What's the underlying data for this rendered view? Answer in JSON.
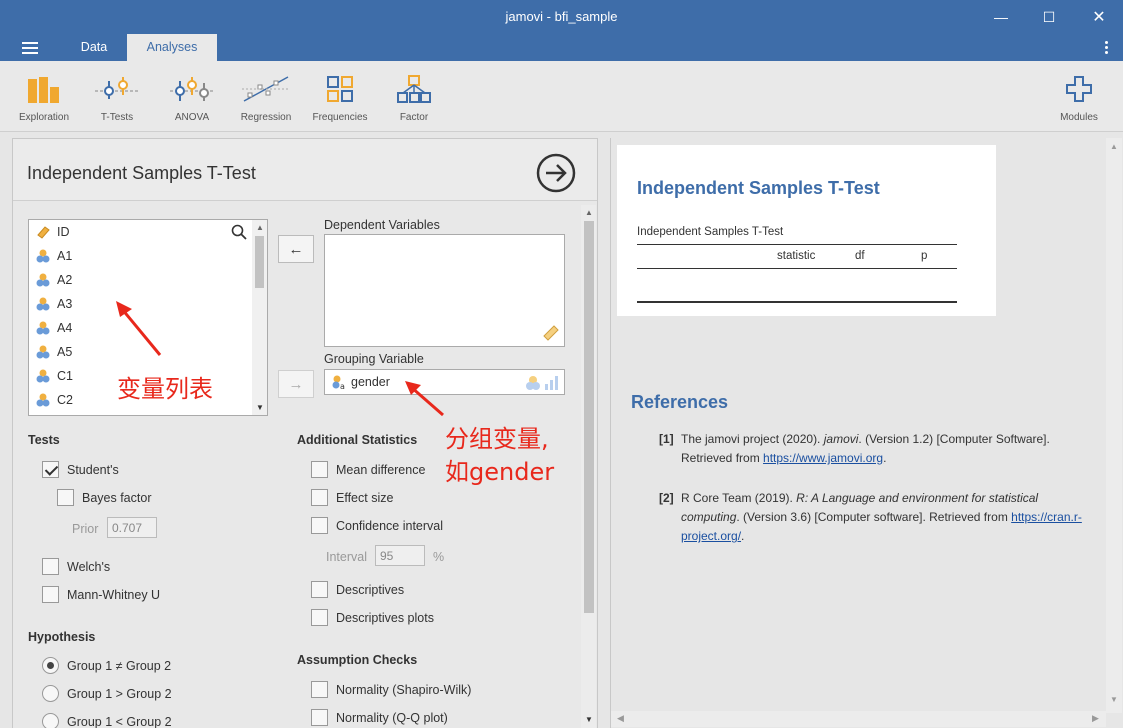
{
  "window": {
    "title": "jamovi - bfi_sample",
    "minimize_glyph": "—",
    "maximize_glyph": "☐",
    "close_glyph": "✕"
  },
  "tabs": [
    {
      "label": "Data"
    },
    {
      "label": "Analyses"
    }
  ],
  "ribbon": {
    "items": [
      {
        "label": "Exploration",
        "icon": "bar-chart-icon"
      },
      {
        "label": "T-Tests",
        "icon": "t-tests-icon"
      },
      {
        "label": "ANOVA",
        "icon": "anova-icon"
      },
      {
        "label": "Regression",
        "icon": "regression-icon"
      },
      {
        "label": "Frequencies",
        "icon": "frequencies-icon"
      },
      {
        "label": "Factor",
        "icon": "factor-icon"
      }
    ],
    "modules_label": "Modules"
  },
  "analysis": {
    "title": "Independent Samples T-Test",
    "variables": [
      {
        "name": "ID",
        "type": "id"
      },
      {
        "name": "A1",
        "type": "nominal"
      },
      {
        "name": "A2",
        "type": "nominal"
      },
      {
        "name": "A3",
        "type": "nominal"
      },
      {
        "name": "A4",
        "type": "nominal"
      },
      {
        "name": "A5",
        "type": "nominal"
      },
      {
        "name": "C1",
        "type": "nominal"
      },
      {
        "name": "C2",
        "type": "nominal"
      }
    ],
    "dependent_label": "Dependent Variables",
    "grouping_label": "Grouping Variable",
    "grouping_value": "gender",
    "move_left_glyph": "←",
    "move_right_glyph": "→",
    "tests": {
      "title": "Tests",
      "students": "Student's",
      "bayes": "Bayes factor",
      "prior_label": "Prior",
      "prior_value": "0.707",
      "welchs": "Welch's",
      "mann_whitney": "Mann-Whitney U"
    },
    "additional": {
      "title": "Additional Statistics",
      "mean_difference": "Mean difference",
      "effect_size": "Effect size",
      "confidence_interval": "Confidence interval",
      "interval_label": "Interval",
      "interval_value": "95",
      "interval_unit": "%",
      "descriptives": "Descriptives",
      "descriptives_plots": "Descriptives plots"
    },
    "hypothesis": {
      "title": "Hypothesis",
      "neq": "Group 1 ≠ Group 2",
      "gt": "Group 1 > Group 2",
      "lt": "Group 1 < Group 2"
    },
    "assumptions": {
      "title": "Assumption Checks",
      "shapiro": "Normality (Shapiro-Wilk)",
      "qq": "Normality (Q-Q plot)"
    }
  },
  "annotations": {
    "var_list": "变量列表",
    "group_var_line1": "分组变量,",
    "group_var_line2": "如gender",
    "color": "#e8281c"
  },
  "results": {
    "title": "Independent Samples T-Test",
    "table_name": "Independent Samples T-Test",
    "columns": [
      "statistic",
      "df",
      "p"
    ]
  },
  "references": {
    "title": "References",
    "items": [
      {
        "num": "[1]",
        "text": "The jamovi project (2020). ",
        "italic": "jamovi",
        "rest": ". (Version 1.2) [Computer Software]. Retrieved from ",
        "link": "https://www.jamovi.org",
        "end": "."
      },
      {
        "num": "[2]",
        "text": "R Core Team (2019). ",
        "italic": "R: A Language and environment for statistical computing",
        "rest": ". (Version 3.6) [Computer software]. Retrieved from ",
        "link": "https://cran.r-project.org/",
        "end": "."
      }
    ]
  },
  "colors": {
    "brand": "#3e6da9",
    "ribbon_orange": "#f0a830",
    "ribbon_blue": "#3e6da9"
  }
}
